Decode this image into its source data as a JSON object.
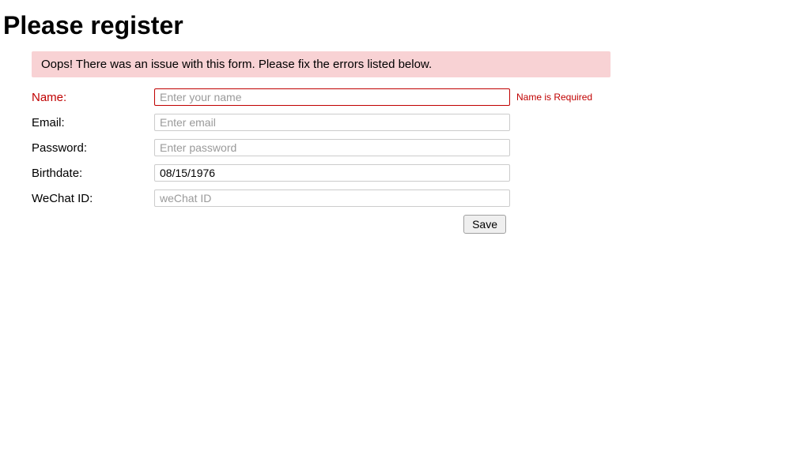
{
  "heading": "Please register",
  "alert": "Oops! There was an issue with this form. Please fix the errors listed below.",
  "fields": {
    "name": {
      "label": "Name:",
      "placeholder": "Enter your name",
      "value": "",
      "error": "Name is Required"
    },
    "email": {
      "label": "Email:",
      "placeholder": "Enter email",
      "value": ""
    },
    "password": {
      "label": "Password:",
      "placeholder": "Enter password",
      "value": ""
    },
    "birthdate": {
      "label": "Birthdate:",
      "placeholder": "",
      "value": "08/15/1976"
    },
    "wechat": {
      "label": "WeChat ID:",
      "placeholder": "weChat ID",
      "value": ""
    }
  },
  "buttons": {
    "save": "Save"
  }
}
